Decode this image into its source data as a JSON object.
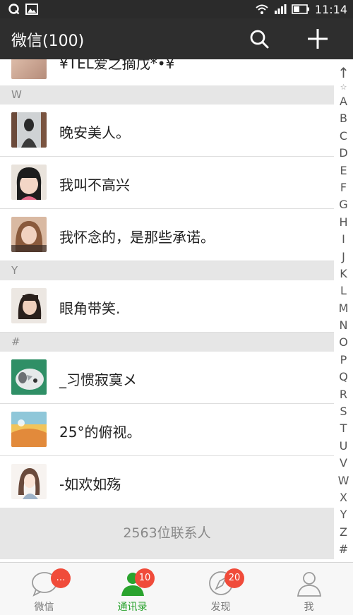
{
  "status": {
    "time": "11:14"
  },
  "appbar": {
    "title": "微信(100)"
  },
  "contacts": {
    "partial_name": "¥TEL爱之摘戊*•¥",
    "sections": [
      {
        "letter": "W",
        "items": [
          {
            "name": "晚安美人。"
          },
          {
            "name": "我叫不高兴"
          },
          {
            "name": "我怀念的，是那些承诺。"
          }
        ]
      },
      {
        "letter": "Y",
        "items": [
          {
            "name": "眼角带笑."
          }
        ]
      },
      {
        "letter": "#",
        "items": [
          {
            "name": "_习惯寂寞メ"
          },
          {
            "name": "25°的俯视。"
          },
          {
            "name": "-如欢如殇"
          }
        ]
      }
    ],
    "count_text": "2563位联系人"
  },
  "index": {
    "up": "↑",
    "star": "☆",
    "letters": [
      "A",
      "B",
      "C",
      "D",
      "E",
      "F",
      "G",
      "H",
      "I",
      "J",
      "K",
      "L",
      "M",
      "N",
      "O",
      "P",
      "Q",
      "R",
      "S",
      "T",
      "U",
      "V",
      "W",
      "X",
      "Y",
      "Z",
      "#"
    ]
  },
  "tabs": [
    {
      "label": "微信",
      "badge": "…"
    },
    {
      "label": "通讯录",
      "badge": "10"
    },
    {
      "label": "发现",
      "badge": "20"
    },
    {
      "label": "我",
      "badge": ""
    }
  ],
  "colors": {
    "accent": "#2aa32e",
    "badge": "#f04b3a",
    "appbar": "#2e2e2e"
  }
}
